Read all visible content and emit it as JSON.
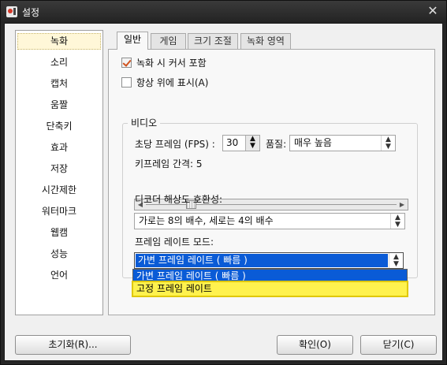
{
  "window": {
    "title": "설정",
    "close_icon": "✕"
  },
  "sidebar": {
    "items": [
      {
        "label": "녹화",
        "selected": true
      },
      {
        "label": "소리"
      },
      {
        "label": "캡처"
      },
      {
        "label": "움짤"
      },
      {
        "label": "단축키"
      },
      {
        "label": "효과"
      },
      {
        "label": "저장"
      },
      {
        "label": "시간제한"
      },
      {
        "label": "워터마크"
      },
      {
        "label": "웹캠"
      },
      {
        "label": "성능"
      },
      {
        "label": "언어"
      }
    ]
  },
  "tabs": [
    {
      "label": "일반",
      "active": true
    },
    {
      "label": "게임"
    },
    {
      "label": "크기 조절"
    },
    {
      "label": "녹화 영역"
    }
  ],
  "general": {
    "include_cursor": {
      "label": "녹화 시 커서 포함",
      "checked": true
    },
    "always_on_top": {
      "label": "항상 위에 표시(A)",
      "checked": false
    }
  },
  "video": {
    "group_title": "비디오",
    "fps_label": "초당 프레임 (FPS) :",
    "fps_value": "30",
    "quality_label": "품질:",
    "quality_value": "매우 높음",
    "keyframe_label": "키프레임 간격: 5",
    "keyframe_value": 5,
    "keyframe_max": 30,
    "decoder_label": "디코더 해상도 호환성:",
    "decoder_value": "가로는 8의 배수, 세로는 4의 배수",
    "framerate_mode_label": "프레임 레이트 모드:",
    "framerate_mode_value": "가변 프레임 레이트 ( 빠름 )",
    "framerate_options": [
      "가변 프레임 레이트 ( 빠름 )",
      "고정 프레임 레이트"
    ]
  },
  "buttons": {
    "reset": "초기화(R)...",
    "ok": "확인(O)",
    "close": "닫기(C)"
  },
  "colors": {
    "selection_blue": "#0a5bd6",
    "highlight_yellow": "#fff24e",
    "check_orange": "#d0521d"
  }
}
